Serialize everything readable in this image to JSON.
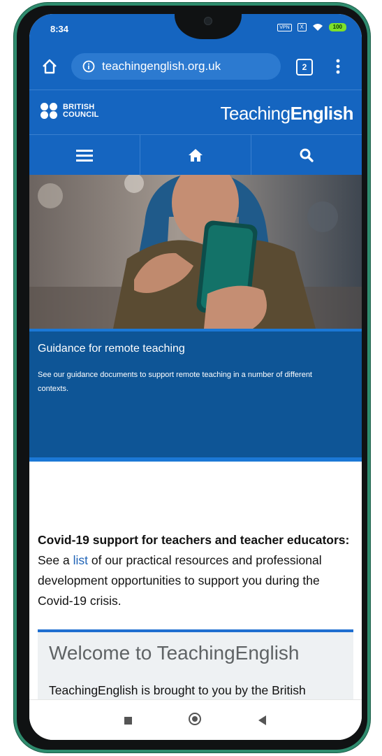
{
  "status_bar": {
    "time": "8:34",
    "vpn_label": "VPN",
    "sim_label": "X",
    "battery_label": "100"
  },
  "browser": {
    "url": "teachingenglish.org.uk",
    "tab_count": "2"
  },
  "site": {
    "logo_line1": "BRITISH",
    "logo_line2": "COUNCIL",
    "brand_light": "Teaching",
    "brand_bold": "English"
  },
  "hero": {
    "title": "Guidance for remote teaching",
    "description": "See our guidance documents to support remote teaching in a number of different contexts."
  },
  "covid": {
    "lead_bold": "Covid-19 support for teachers and teacher educators:",
    "text_before_link": " See a ",
    "link_text": "list",
    "text_after_link": " of our practical resources and professional development opportunities to support you during the Covid-19 crisis."
  },
  "welcome": {
    "title": "Welcome to TeachingEnglish",
    "text": "TeachingEnglish is brought to you by the British Council, the world's English teaching experts. If"
  },
  "colors": {
    "brand_blue": "#1565c0",
    "banner_blue": "#0e5596",
    "link_blue": "#1f63b6"
  }
}
